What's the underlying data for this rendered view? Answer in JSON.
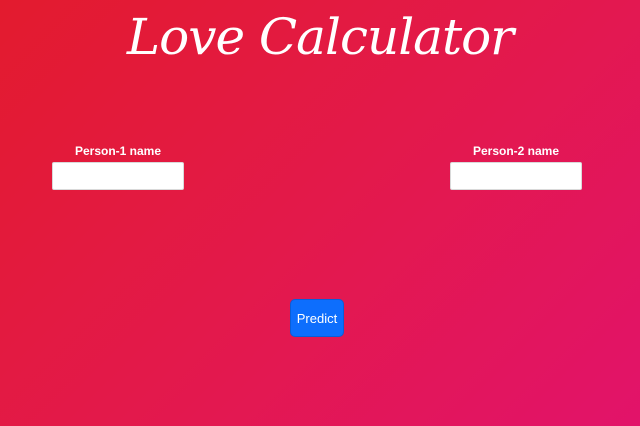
{
  "header": {
    "title": "Love Calculator"
  },
  "form": {
    "person1": {
      "label": "Person-1 name",
      "value": "",
      "placeholder": ""
    },
    "person2": {
      "label": "Person-2 name",
      "value": "",
      "placeholder": ""
    },
    "predict_label": "Predict"
  },
  "colors": {
    "background_start": "#e31b2e",
    "background_end": "#e2136a",
    "button": "#0d6efd",
    "text": "#ffffff"
  }
}
